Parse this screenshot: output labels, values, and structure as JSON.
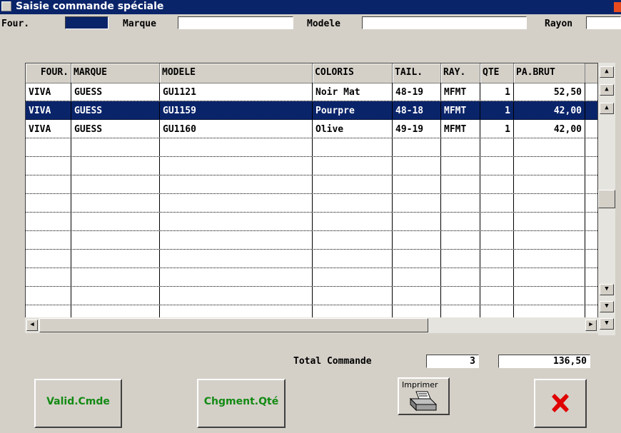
{
  "window": {
    "title": "Saisie commande spéciale"
  },
  "filters": {
    "four_label": "Four.",
    "marque_label": "Marque",
    "modele_label": "Modele",
    "rayon_label": "Rayon",
    "four_value": "",
    "marque_value": "",
    "modele_value": "",
    "rayon_value": ""
  },
  "grid": {
    "columns": [
      "FOUR.",
      "MARQUE",
      "MODELE",
      "COLORIS",
      "TAIL.",
      "RAY.",
      "QTE",
      "PA.BRUT"
    ],
    "rows": [
      [
        "VIVA",
        "GUESS",
        "GU1121",
        "Noir Mat",
        "48-19",
        "MFMT",
        "1",
        "52,50"
      ],
      [
        "VIVA",
        "GUESS",
        "GU1159",
        "Pourpre",
        "48-18",
        "MFMT",
        "1",
        "42,00"
      ],
      [
        "VIVA",
        "GUESS",
        "GU1160",
        "Olive",
        "49-19",
        "MFMT",
        "1",
        "42,00"
      ]
    ],
    "selected_row": 1
  },
  "totals": {
    "label": "Total Commande",
    "quantity": "3",
    "amount": "136,50"
  },
  "buttons": {
    "valid": "Valid.Cmde",
    "change_qty": "Chgment.Qté",
    "print": "Imprimer"
  },
  "icons": {
    "print": "printer-icon",
    "close": "red-x-icon"
  },
  "colors": {
    "selection": "#0a246a",
    "button_text": "#138a13",
    "cancel": "#e00000"
  }
}
